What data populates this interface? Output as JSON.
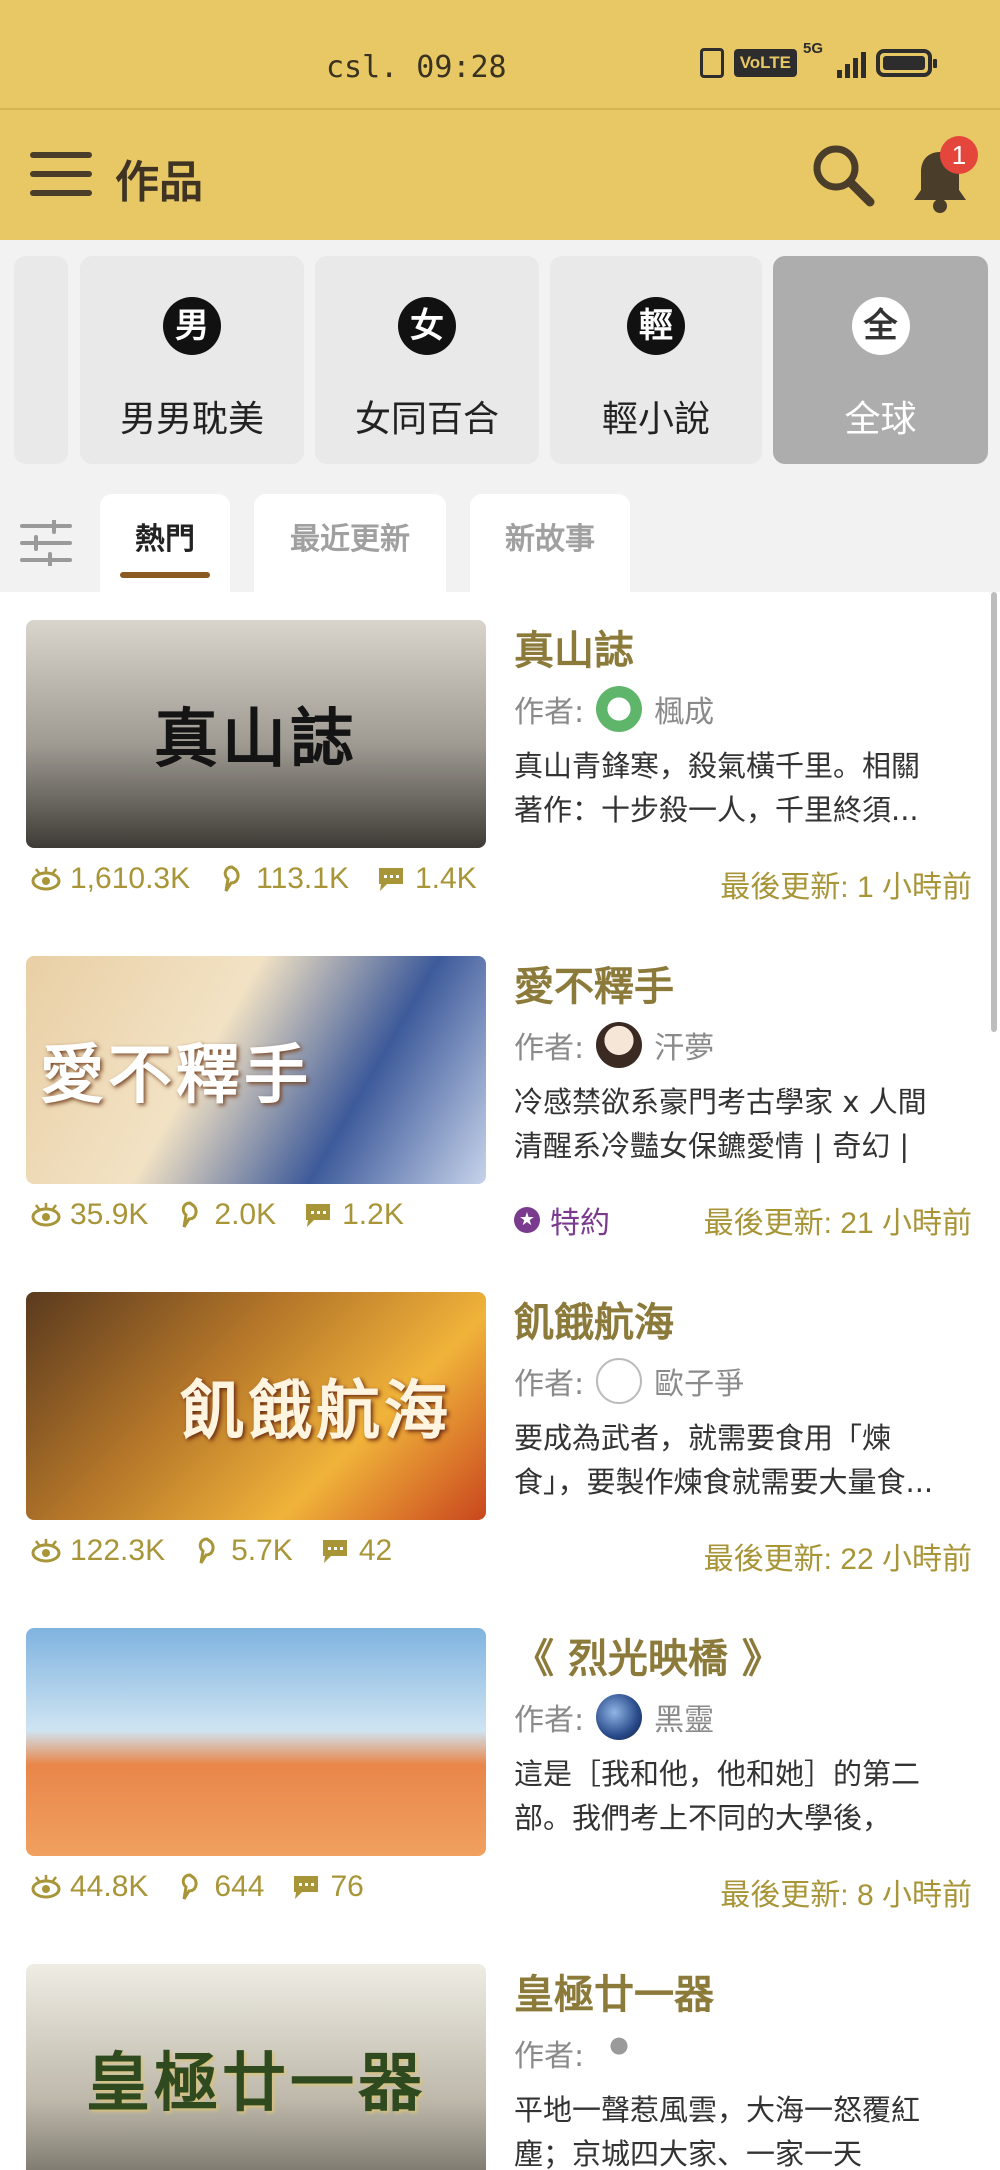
{
  "status_bar": {
    "time": "csl. 09:28",
    "volte": "VoLTE",
    "network": "5G"
  },
  "header": {
    "title": "作品",
    "notification_count": "1"
  },
  "categories": [
    {
      "glyph": "男",
      "label": "男男耽美"
    },
    {
      "glyph": "女",
      "label": "女同百合"
    },
    {
      "glyph": "輕",
      "label": "輕小說"
    },
    {
      "glyph": "全",
      "label": "全球"
    }
  ],
  "tabs": [
    "熱門",
    "最近更新",
    "新故事"
  ],
  "stories": [
    {
      "title": "真山誌",
      "author_label": "作者:",
      "author": "楓成",
      "description": "真山青鋒寒，殺氣橫千里。相關著作：十步殺一人，千里終須...",
      "views": "1,610.3K",
      "likes": "113.1K",
      "comments": "1.4K",
      "updated": "最後更新: 1 小時前",
      "cover_text": "真山誌"
    },
    {
      "title": "愛不釋手",
      "author_label": "作者:",
      "author": "汗夢",
      "description": "冷感禁欲系豪門考古學家 x 人間清醒系冷豔女保鑣愛情 | 奇幻 | ...",
      "views": "35.9K",
      "likes": "2.0K",
      "comments": "1.2K",
      "contract": "特約",
      "updated": "最後更新: 21 小時前",
      "cover_text": "愛不釋手"
    },
    {
      "title": "飢餓航海",
      "author_label": "作者:",
      "author": "歐子爭",
      "description": "要成為武者，就需要食用「煉食」，要製作煉食就需要大量食...",
      "views": "122.3K",
      "likes": "5.7K",
      "comments": "42",
      "updated": "最後更新: 22 小時前",
      "cover_text": "飢餓航海"
    },
    {
      "title": "《 烈光映橋 》",
      "author_label": "作者:",
      "author": "黑靈",
      "description": "這是［我和他，他和她］的第二部。我們考上不同的大學後，光...",
      "views": "44.8K",
      "likes": "644",
      "comments": "76",
      "updated": "最後更新: 8 小時前",
      "cover_text": ""
    },
    {
      "title": "皇極廿一器",
      "author_label": "作者:",
      "author": "",
      "description": "平地一聲惹風雲，大海一怒覆紅塵；京城四大家、一家一天下。...",
      "views": "",
      "likes": "",
      "comments": "",
      "updated": "",
      "cover_text": "皇極廿一器"
    }
  ],
  "colors": {
    "header_bg": "#e8c865",
    "title_color": "#8b7a3a",
    "stat_color": "#a89538",
    "contract_color": "#7a3b8f",
    "tab_underline": "#8a5a22"
  }
}
